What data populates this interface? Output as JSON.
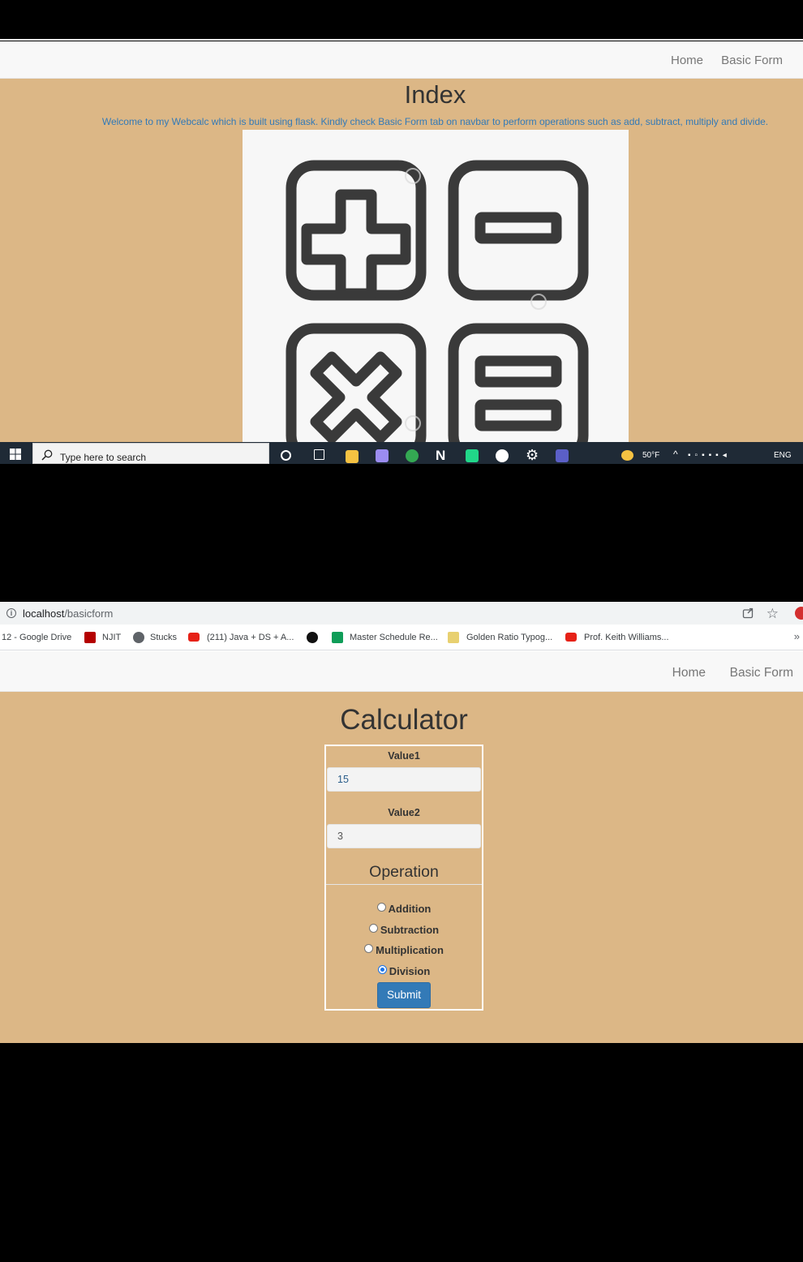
{
  "screen1": {
    "navbar": {
      "home": "Home",
      "basic_form": "Basic Form"
    },
    "title": "Index",
    "welcome": {
      "before": "Welcome to my Webcalc which is built using flask. Kindly check ",
      "link": "Basic Form",
      "after": " tab on navbar to perform operations such as add, subtract, multiply and divide."
    },
    "image": {
      "icons": [
        "plus-icon",
        "minus-icon",
        "multiply-icon",
        "equals-icon"
      ]
    },
    "taskbar": {
      "search_placeholder": "Type here to search",
      "weather": "50°F",
      "language": "ENG"
    }
  },
  "screen2": {
    "address_bar": {
      "host": "localhost",
      "path": "/basicform"
    },
    "bookmarks": [
      {
        "label": "12 - Google Drive",
        "icon": "drive-icon"
      },
      {
        "label": "NJIT",
        "icon": "njit-icon",
        "color": "#b40000"
      },
      {
        "label": "Stucks",
        "icon": "globe-icon",
        "color": "#5f6368"
      },
      {
        "label": "(211) Java + DS + A...",
        "icon": "youtube-icon",
        "color": "#e62117"
      },
      {
        "label": "",
        "icon": "github-icon",
        "color": "#111111"
      },
      {
        "label": "Master Schedule Re...",
        "icon": "sheets-icon",
        "color": "#0f9d58"
      },
      {
        "label": "Golden Ratio Typog...",
        "icon": "phi-icon",
        "color": "#e8d070"
      },
      {
        "label": "Prof. Keith Williams...",
        "icon": "youtube-icon",
        "color": "#e62117"
      }
    ],
    "navbar": {
      "home": "Home",
      "basic_form": "Basic Form"
    },
    "title": "Calculator",
    "form": {
      "value1_label": "Value1",
      "value1": "15",
      "value2_label": "Value2",
      "value2": "3",
      "operation_legend": "Operation",
      "operations": [
        "Addition",
        "Subtraction",
        "Multiplication",
        "Division"
      ],
      "selected_operation": "Division",
      "submit": "Submit"
    }
  },
  "colors": {
    "page_bg": "#dcb786",
    "link": "#337ab7",
    "button": "#337ab7",
    "navbar": "#f8f8f8"
  }
}
